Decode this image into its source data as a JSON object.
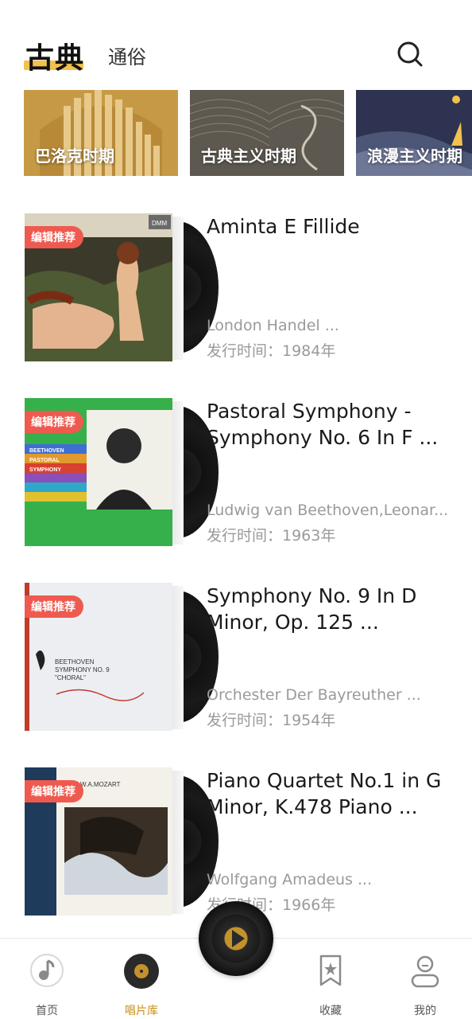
{
  "header": {
    "tab_active": "古典",
    "tab_inactive": "通俗"
  },
  "eras": [
    {
      "label": "巴洛克时期"
    },
    {
      "label": "古典主义时期"
    },
    {
      "label": "浪漫主义时期"
    }
  ],
  "albums": [
    {
      "badge": "编辑推荐",
      "title": "Aminta E Fillide",
      "artist": "London Handel ...",
      "date": "发行时间：1984年"
    },
    {
      "badge": "编辑推荐",
      "title": "Pastoral Symphony - Symphony No. 6 In F ...",
      "artist": "Ludwig van Beethoven,Leonar...",
      "date": "发行时间：1963年"
    },
    {
      "badge": "编辑推荐",
      "title": "Symphony No. 9 In D Minor, Op. 125 ...",
      "artist": "Orchester Der Bayreuther ...",
      "date": "发行时间：1954年"
    },
    {
      "badge": "编辑推荐",
      "title": "Piano Quartet No.1 in G Minor, K.478 Piano ...",
      "artist": "Wolfgang Amadeus ...",
      "date": "发行时间：1966年"
    }
  ],
  "cover_text": {
    "aminta_brand": "DMM",
    "beethoven6_lines": [
      "BEETHOVEN",
      "PASTORAL",
      "SYMPHONY"
    ],
    "beethoven9_lines": [
      "BEETHOVEN",
      "SYMPHONY NO. 9",
      "\"CHORAL\""
    ],
    "mozart_line": "W.A.MOZART"
  },
  "nav": {
    "home": "首页",
    "records": "唱片库",
    "favorites": "收藏",
    "mine": "我的",
    "active": "records"
  },
  "colors": {
    "accent": "#f2c14e",
    "badge": "#ee5a4f",
    "active_nav": "#c98e1a"
  }
}
